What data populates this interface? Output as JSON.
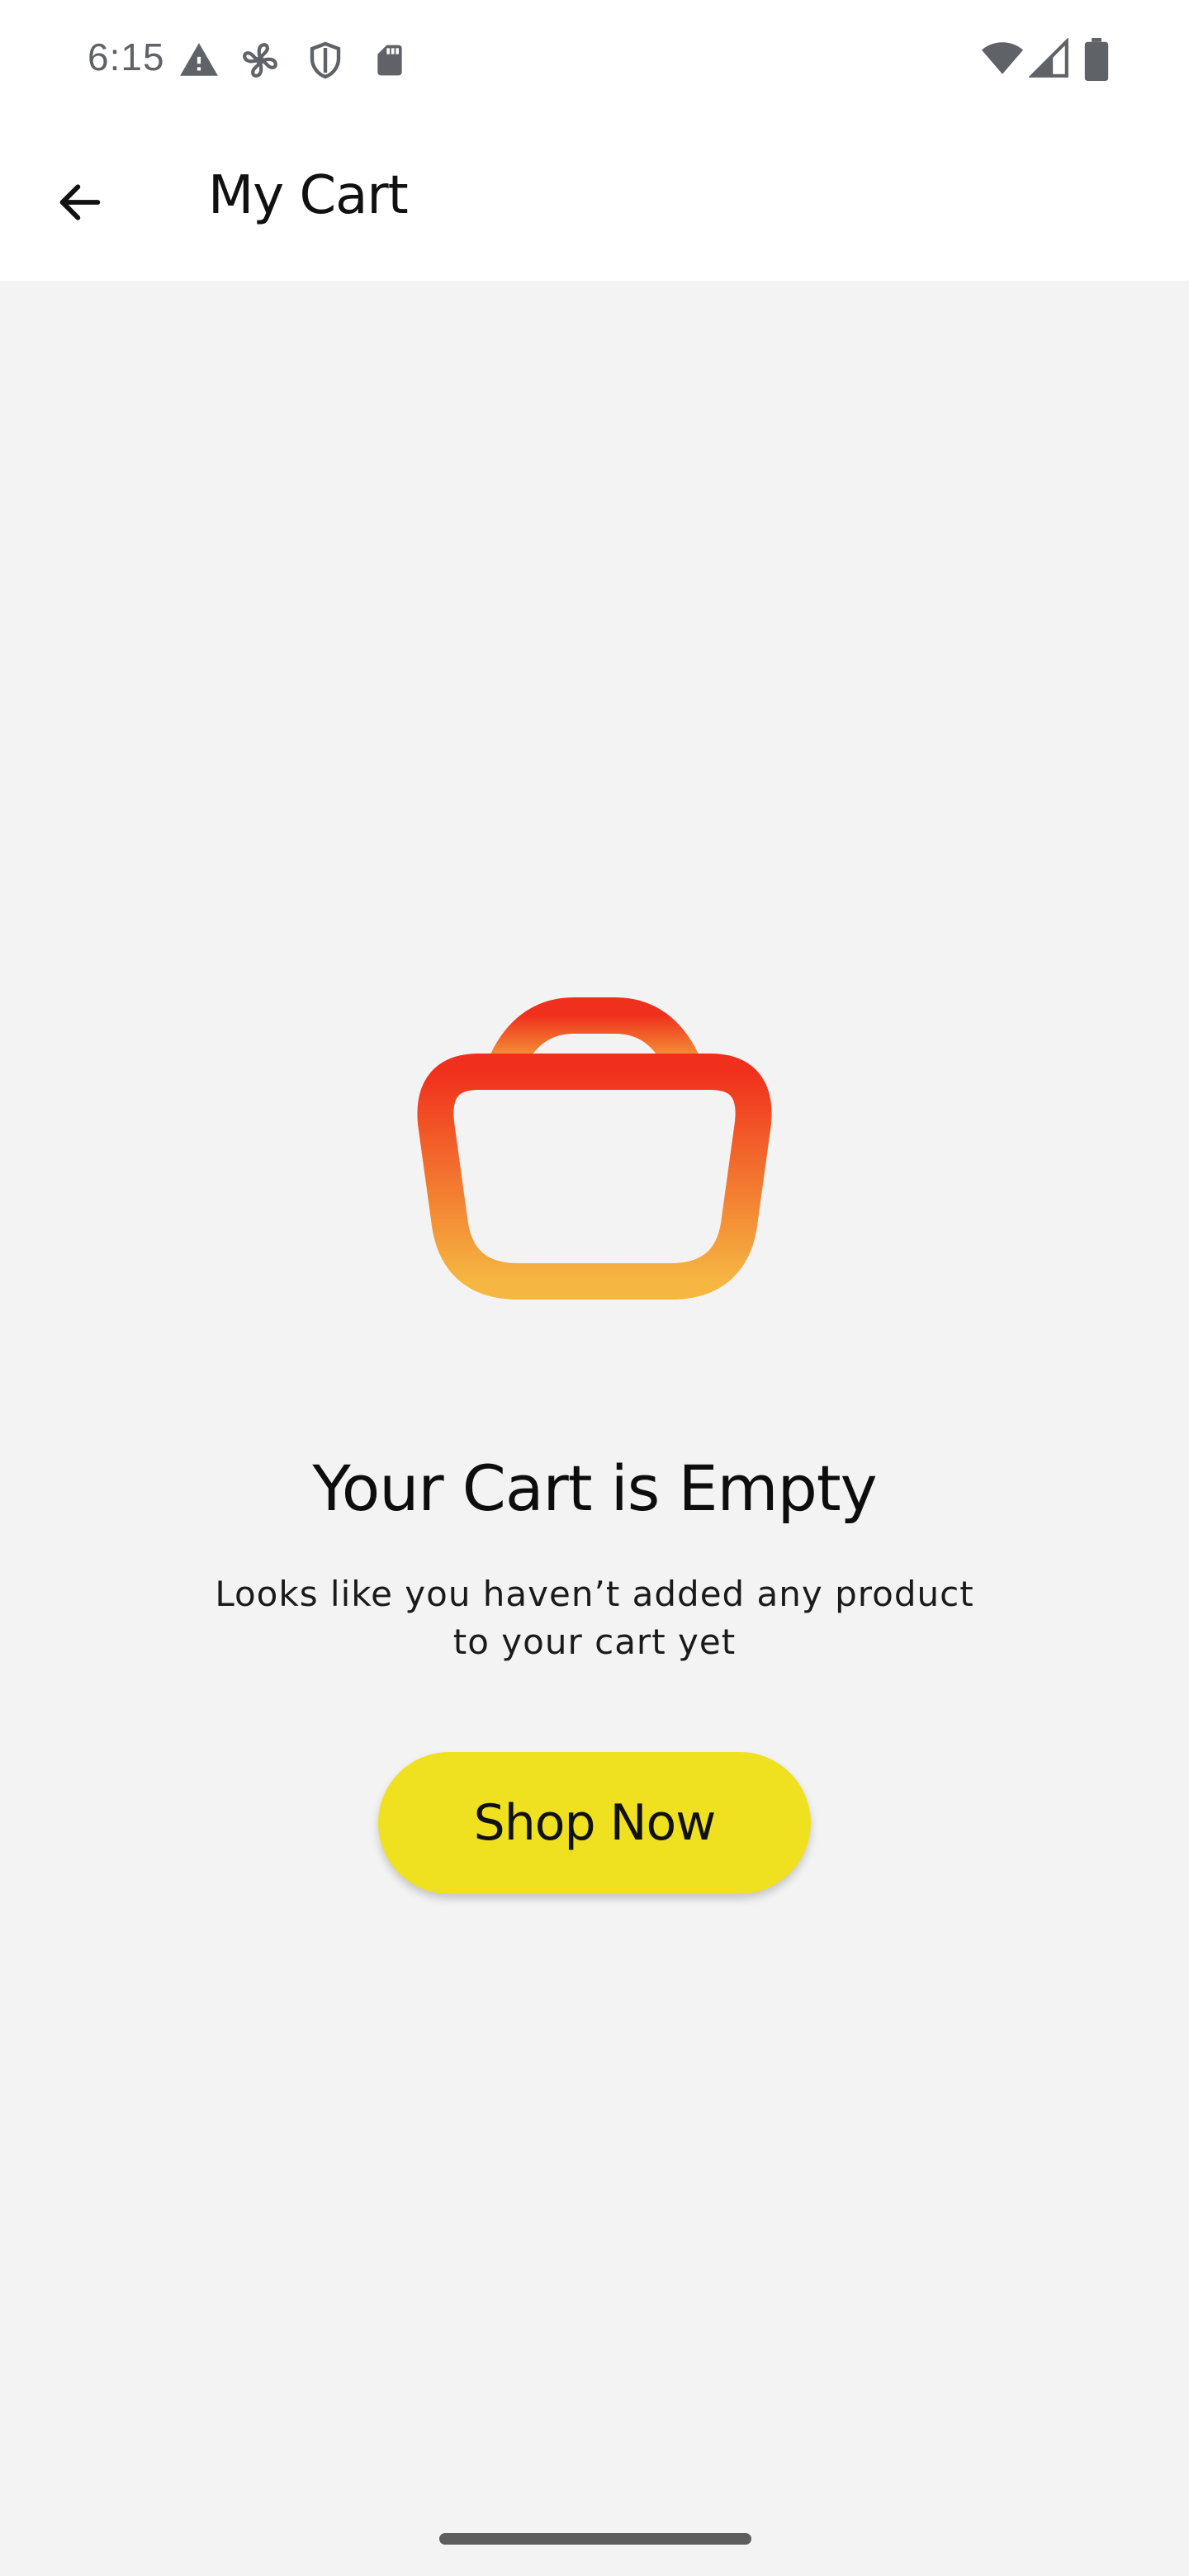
{
  "status_bar": {
    "time": "6:15",
    "left_icons": [
      "warning-icon",
      "fan-icon",
      "shield-icon",
      "sd-card-icon"
    ],
    "right_icons": [
      "wifi-icon",
      "signal-icon",
      "battery-icon"
    ]
  },
  "app_bar": {
    "back_icon": "arrow-left-icon",
    "title": "My Cart"
  },
  "empty_state": {
    "icon": "shopping-bag-icon",
    "title": "Your Cart is Empty",
    "subtitle_line1": "Looks like you haven’t added any product",
    "subtitle_line2": "to your cart yet",
    "button_label": "Shop Now"
  },
  "colors": {
    "background": "#f3f3f3",
    "bar_background": "#ffffff",
    "button": "#efe020",
    "icon_gradient_top": "#f0301c",
    "icon_gradient_bottom": "#f5b741"
  }
}
